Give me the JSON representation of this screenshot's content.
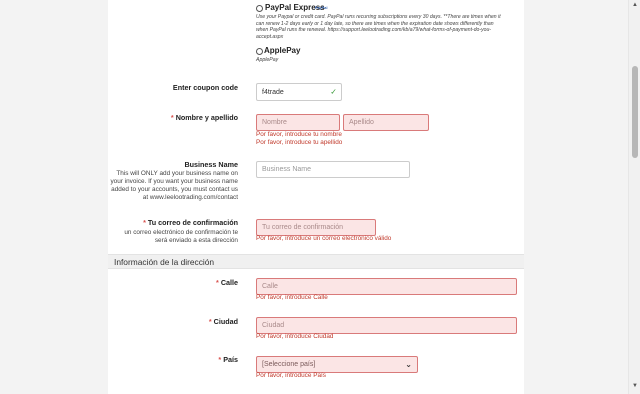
{
  "payment_methods": [
    {
      "title": "PayPal Express",
      "badge": "PayPal",
      "description_lines": [
        "Use your Paypal or credit card. PayPal runs recurring subscriptions every 30 days. **There are times when it",
        "can renew 1-2 days early or 1 day late, so there are times when the expiration date shows differently than",
        "when PayPal runs the renewal. https://support.leelootrading.com/kb/a79/what-forms-of-payment-do-you-",
        "accept.aspx"
      ]
    },
    {
      "title": "ApplePay",
      "subtitle": "ApplePay"
    }
  ],
  "coupon": {
    "label": "Enter coupon code",
    "value": "f4trade",
    "valid_icon": "checkmark-icon"
  },
  "name": {
    "required": "*",
    "label": "Nombre y apellido",
    "first_placeholder": "Nombre",
    "last_placeholder": "Apellido",
    "errors": [
      "Por favor, introduce tu nombre",
      "Por favor, introduce tu apellido"
    ]
  },
  "business": {
    "label": "Business Name",
    "help_lines": [
      "This will ONLY add your business name on",
      "your invoice. If you want your business name",
      "added to your accounts, you must contact us",
      "at www.leelootrading.com/contact"
    ],
    "placeholder": "Business Name"
  },
  "email_confirm": {
    "required": "*",
    "label": "Tu correo de confirmación",
    "help_lines": [
      "un correo electrónico de confirmación te",
      "será enviado a esta dirección"
    ],
    "placeholder": "Tu correo de confirmación",
    "error": "Por favor, introduce un correo electrónico válido"
  },
  "address_section": {
    "title": "Información de la dirección"
  },
  "street": {
    "required": "*",
    "label": "Calle",
    "placeholder": "Calle",
    "error": "Por favor, introduce Calle"
  },
  "city": {
    "required": "*",
    "label": "Ciudad",
    "placeholder": "Ciudad",
    "error": "Por favor, introduce Ciudad"
  },
  "country": {
    "required": "*",
    "label": "País",
    "selected": "[Seleccione país]",
    "error": "Por favor, introduce País"
  },
  "colors": {
    "error_text": "#c0392b",
    "error_bg": "#fbe5e5",
    "required_star": "#d9534f"
  }
}
